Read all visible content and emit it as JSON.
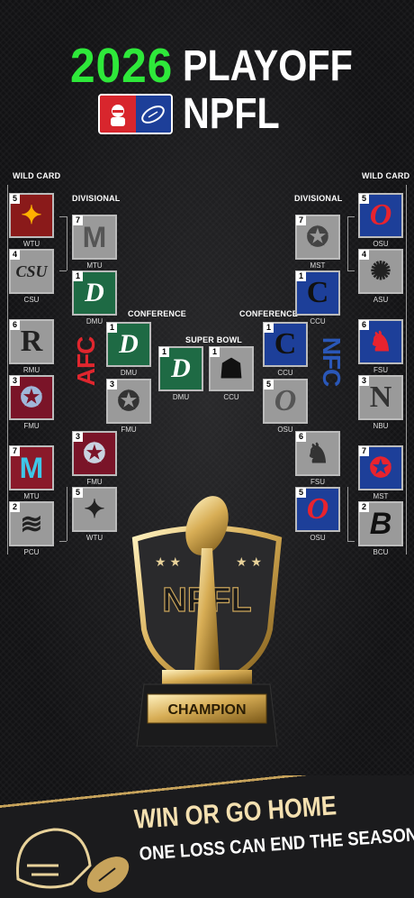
{
  "header": {
    "year": "2026",
    "word": "PLAYOFF",
    "league": "NPFL"
  },
  "rounds": {
    "wild_card": "WILD CARD",
    "divisional": "DIVISIONAL",
    "conference": "CONFERENCE",
    "super_bowl": "SUPER BOWL"
  },
  "conferences": {
    "left": "AFC",
    "right": "NFC"
  },
  "teams": {
    "afc_wc": [
      {
        "seed": "5",
        "abbr": "WTU",
        "glyph": "✦",
        "bg": "#8a1a1a",
        "fg": "#ffb000"
      },
      {
        "seed": "4",
        "abbr": "CSU",
        "glyph": "CSU",
        "bg": "#9a9a9a",
        "fg": "#222"
      },
      {
        "seed": "6",
        "abbr": "RMU",
        "glyph": "R",
        "bg": "#9a9a9a",
        "fg": "#222"
      },
      {
        "seed": "3",
        "abbr": "FMU",
        "glyph": "✪",
        "bg": "#7a1428",
        "fg": "#9fb7d9"
      },
      {
        "seed": "7",
        "abbr": "MTU",
        "glyph": "M",
        "bg": "#8a1a2a",
        "fg": "#3ec7e8"
      },
      {
        "seed": "2",
        "abbr": "PCU",
        "glyph": "≋",
        "bg": "#9a9a9a",
        "fg": "#222"
      }
    ],
    "afc_div": [
      {
        "seed": "7",
        "abbr": "MTU",
        "glyph": "M",
        "bg": "#9a9a9a",
        "fg": "#555"
      },
      {
        "seed": "1",
        "abbr": "DMU",
        "glyph": "D",
        "bg": "#1e6a44",
        "fg": "#fff"
      },
      {
        "seed": "3",
        "abbr": "FMU",
        "glyph": "✪",
        "bg": "#7a1428",
        "fg": "#c9d3e0"
      },
      {
        "seed": "5",
        "abbr": "WTU",
        "glyph": "✦",
        "bg": "#9a9a9a",
        "fg": "#222"
      }
    ],
    "afc_conf": [
      {
        "seed": "1",
        "abbr": "DMU",
        "glyph": "D",
        "bg": "#1e6a44",
        "fg": "#fff"
      },
      {
        "seed": "3",
        "abbr": "FMU",
        "glyph": "✪",
        "bg": "#9a9a9a",
        "fg": "#333"
      }
    ],
    "sb": [
      {
        "seed": "1",
        "abbr": "DMU",
        "glyph": "D",
        "bg": "#1e6a44",
        "fg": "#fff"
      },
      {
        "seed": "1",
        "abbr": "CCU",
        "glyph": "☗",
        "bg": "#9a9a9a",
        "fg": "#111"
      }
    ],
    "nfc_conf": [
      {
        "seed": "1",
        "abbr": "CCU",
        "glyph": "C",
        "bg": "#1d3f99",
        "fg": "#111"
      },
      {
        "seed": "5",
        "abbr": "OSU",
        "glyph": "O",
        "bg": "#9a9a9a",
        "fg": "#555"
      }
    ],
    "nfc_div": [
      {
        "seed": "7",
        "abbr": "MST",
        "glyph": "✪",
        "bg": "#9a9a9a",
        "fg": "#444"
      },
      {
        "seed": "1",
        "abbr": "CCU",
        "glyph": "C",
        "bg": "#1d3f99",
        "fg": "#111"
      },
      {
        "seed": "6",
        "abbr": "FSU",
        "glyph": "♞",
        "bg": "#9a9a9a",
        "fg": "#333"
      },
      {
        "seed": "5",
        "abbr": "OSU",
        "glyph": "O",
        "bg": "#1d3f99",
        "fg": "#e8232e"
      }
    ],
    "nfc_wc": [
      {
        "seed": "5",
        "abbr": "OSU",
        "glyph": "O",
        "bg": "#1d3f99",
        "fg": "#e8232e"
      },
      {
        "seed": "4",
        "abbr": "ASU",
        "glyph": "✺",
        "bg": "#9a9a9a",
        "fg": "#222"
      },
      {
        "seed": "6",
        "abbr": "FSU",
        "glyph": "♞",
        "bg": "#1d3f99",
        "fg": "#e8232e"
      },
      {
        "seed": "3",
        "abbr": "NBU",
        "glyph": "N",
        "bg": "#9a9a9a",
        "fg": "#333"
      },
      {
        "seed": "7",
        "abbr": "MST",
        "glyph": "✪",
        "bg": "#1d3f99",
        "fg": "#e8232e"
      },
      {
        "seed": "2",
        "abbr": "BCU",
        "glyph": "B",
        "bg": "#9a9a9a",
        "fg": "#111"
      }
    ]
  },
  "trophy": {
    "shield_text": "NPFL",
    "plaque": "CHAMPION"
  },
  "banner": {
    "line1": "WIN OR GO HOME",
    "line2": "ONE LOSS CAN END THE SEASON"
  },
  "colors": {
    "accent_green": "#2ee83a",
    "gold": "#c7a35b",
    "afc_red": "#e0262e",
    "nfc_blue": "#2a57b8"
  }
}
